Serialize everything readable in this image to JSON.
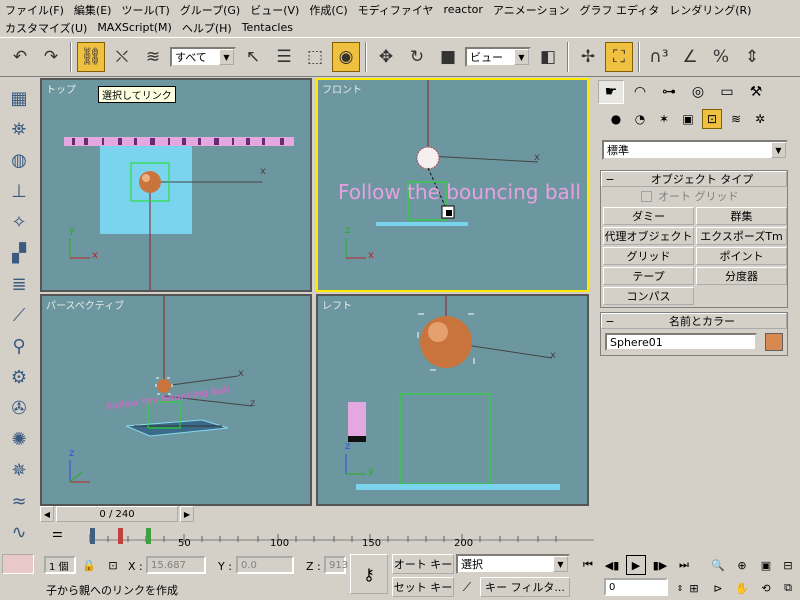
{
  "menus": {
    "row1": [
      "ファイル(F)",
      "編集(E)",
      "ツール(T)",
      "グループ(G)",
      "ビュー(V)",
      "作成(C)",
      "モディファイヤ",
      "reactor",
      "アニメーション",
      "グラフ エディタ",
      "レンダリング(R)"
    ],
    "row2": [
      "カスタマイズ(U)",
      "MAXScript(M)",
      "ヘルプ(H)",
      "Tentacles"
    ]
  },
  "toolbar": {
    "filter_value": "すべて",
    "coord_value": "ビュー"
  },
  "viewports": {
    "top": {
      "label": "トップ",
      "tooltip": "選択してリンク",
      "axis_x": "x",
      "axis_y": "y",
      "axis_x2": "x"
    },
    "front": {
      "label": "フロント",
      "text": "Follow the bouncing ball",
      "axis_x": "x",
      "axis_y": "z",
      "axis_x2": "x"
    },
    "persp": {
      "label": "パースペクティブ",
      "text": "Follow the bouncing ball",
      "axis_x": "x",
      "axis_y": "z",
      "axis_z": "z"
    },
    "left": {
      "label": "レフト",
      "axis_x": "x",
      "axis_y": "z",
      "axis_y2": "y"
    }
  },
  "cmd": {
    "category": "標準",
    "objtype_title": "オブジェクト タイプ",
    "autogrid": "オート グリッド",
    "buttons": [
      "ダミー",
      "群集",
      "代理オブジェクト",
      "エクスポーズTm",
      "グリッド",
      "ポイント",
      "テープ",
      "分度器",
      "コンパス"
    ],
    "namecolor_title": "名前とカラー",
    "name_value": "Sphere01",
    "object_color": "#d98850"
  },
  "time": {
    "slider": "0 / 240",
    "ticks": [
      "50",
      "100",
      "150",
      "200"
    ]
  },
  "status": {
    "count": "1 個",
    "x_label": "X :",
    "x_value": "15.687",
    "y_label": "Y :",
    "y_value": "0.0",
    "z_label": "Z :",
    "z_value": "913",
    "autokey": "オート キー",
    "setkey": "セット キー",
    "sel_value": "選択",
    "keyfilter": "キー フィルタ...",
    "frame_value": "0",
    "prompt": "子から親へのリンクを作成"
  }
}
